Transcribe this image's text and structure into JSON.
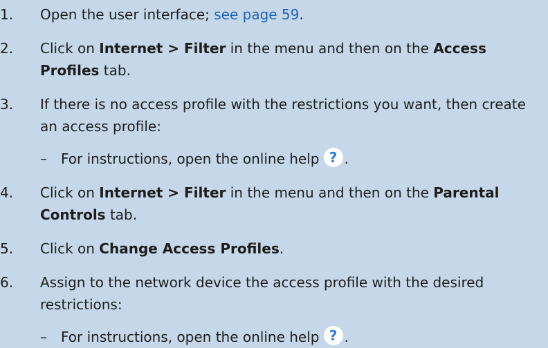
{
  "steps": [
    {
      "num": "1.",
      "text_before": "Open the user interface; ",
      "link": "see page 59",
      "text_after": "."
    },
    {
      "num": "2.",
      "text1": "Click on ",
      "bold1": "Internet > Filter",
      "text2": " in the menu and then on the ",
      "bold2": "Access Profiles",
      "text3": " tab."
    },
    {
      "num": "3.",
      "text": "If there is no access profile with the restrictions you want, then create an access profile:",
      "sub": {
        "dash": "–",
        "text": "For instructions, open the online help",
        "icon": "?",
        "after": "."
      }
    },
    {
      "num": "4.",
      "text1": "Click on ",
      "bold1": "Internet > Filter",
      "text2": " in the menu and then on the ",
      "bold2": "Parental Controls",
      "text3": " tab."
    },
    {
      "num": "5.",
      "text1": "Click on ",
      "bold1": "Change Access Profiles",
      "text2": "."
    },
    {
      "num": "6.",
      "text": "Assign to the network device the access profile with the desired restrictions:",
      "sub": {
        "dash": "–",
        "text": "For instructions, open the online help",
        "icon": "?",
        "after": "."
      }
    }
  ],
  "colors": {
    "background": "#c5d7e9",
    "link": "#1f64b4",
    "help_icon": "#2a7fd6"
  },
  "icons": {
    "help": "question-mark-help-icon"
  }
}
